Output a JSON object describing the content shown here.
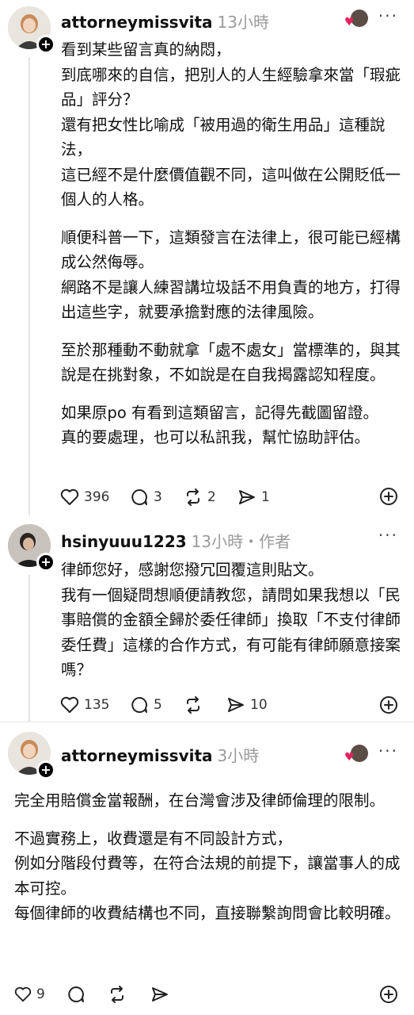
{
  "posts": [
    {
      "username": "attorneymissvita",
      "time": "13小時",
      "paragraphs": [
        "看到某些留言真的納悶，\n到底哪來的自信，把別人的人生經驗拿來當「瑕疵品」評分？\n還有把女性比喻成「被用過的衛生用品」這種說法，\n這已經不是什麼價值觀不同，這叫做在公開貶低一個人的人格。",
        "順便科普一下，這類發言在法律上，很可能已經構成公然侮辱。\n網路不是讓人練習講垃圾話不用負責的地方，打得出這些字，就要承擔對應的法律風險。",
        "至於那種動不動就拿「處不處女」當標準的，與其說是在挑對象，不如說是在自我揭露認知程度。",
        "如果原po 有看到這類留言，記得先截圖留證。\n真的要處理，也可以私訊我，幫忙協助評估。"
      ],
      "likes": "396",
      "comments": "3",
      "reposts": "2",
      "shares": "1"
    },
    {
      "username": "hsinyuuu1223",
      "time": "13小時・作者",
      "paragraphs": [
        "律師您好，感謝您撥冗回覆這則貼文。\n我有一個疑問想順便請教您，請問如果我想以「民事賠償的金額全歸於委任律師」換取「不支付律師委任費」這樣的合作方式，有可能有律師願意接案嗎？"
      ],
      "likes": "135",
      "comments": "5",
      "reposts": "",
      "shares": "10"
    },
    {
      "username": "attorneymissvita",
      "time": "3小時",
      "paragraphs": [
        "完全用賠償金當報酬，在台灣會涉及律師倫理的限制。",
        "不過實務上，收費還是有不同設計方式，\n例如分階段付費等，在符合法規的前提下，讓當事人的成本可控。\n每個律師的收費結構也不同，直接聯繫詢問會比較明確。"
      ],
      "likes": "9"
    }
  ],
  "more_label": "···",
  "avatar_plus": "+",
  "heart": "♥"
}
